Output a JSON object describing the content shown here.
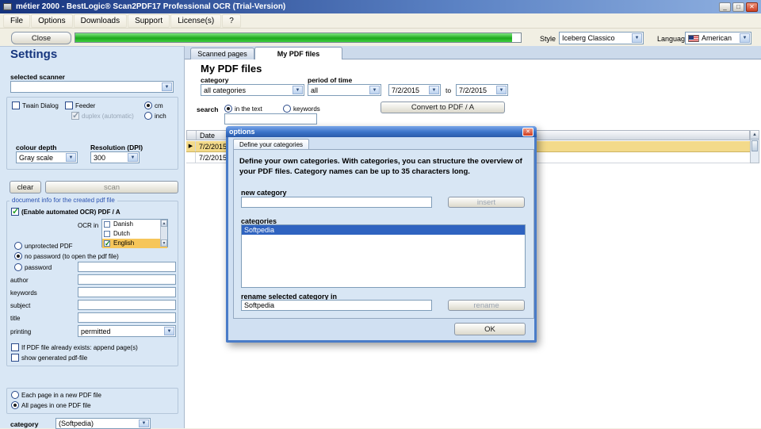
{
  "window": {
    "title": "métier 2000 - BestLogic® Scan2PDF17 Professional OCR (Trial-Version)",
    "controls": {
      "minimize": "_",
      "maximize": "□",
      "close": "✕"
    }
  },
  "menu": {
    "items": [
      "File",
      "Options",
      "Downloads",
      "Support",
      "License(s)",
      "?"
    ]
  },
  "toolbar": {
    "close_label": "Close",
    "progress_percent": 98,
    "style_label": "Style",
    "style_value": "Iceberg Classico",
    "language_label": "Language",
    "language_value": "American"
  },
  "settings": {
    "title": "Settings",
    "scanner_label": "selected scanner",
    "twain_label": "Twain Dialog",
    "feeder_label": "Feeder",
    "duplex_label": "duplex (automatic)",
    "cm_label": "cm",
    "inch_label": "inch",
    "colour_depth_label": "colour depth",
    "colour_depth_value": "Gray scale",
    "resolution_label": "Resolution (DPI)",
    "resolution_value": "300",
    "clear_label": "clear",
    "scan_label": "scan",
    "docinfo_title": "document info for the created pdf file",
    "ocr_checkbox_label": "(Enable automated OCR) PDF / A",
    "ocr_in_label": "OCR in",
    "ocr_languages": [
      {
        "label": "Danish",
        "checked": false
      },
      {
        "label": "Dutch",
        "checked": false
      },
      {
        "label": "English",
        "checked": true
      }
    ],
    "unprotected_label": "unprotected PDF",
    "no_password_label": "no password (to open the pdf file)",
    "password_label": "password",
    "author_label": "author",
    "keywords_label": "keywords",
    "subject_label": "subject",
    "title_label": "title",
    "printing_label": "printing",
    "printing_value": "permitted",
    "append_label": "If PDF file already exists: append page(s)",
    "show_generated_label": "show generated pdf-file",
    "each_page_label": "Each page in a new PDF file",
    "all_pages_label": "All pages in one PDF file",
    "category_label": "category",
    "category_value": "(Softpedia)"
  },
  "main": {
    "tabs": [
      {
        "label": "Scanned pages"
      },
      {
        "label": "My PDF files"
      }
    ],
    "heading": "My PDF files",
    "category_label": "category",
    "category_value": "all categories",
    "period_label": "period of time",
    "period_value": "all",
    "date_from": "7/2/2015",
    "to_label": "to",
    "date_to": "7/2/2015",
    "search_label": "search",
    "in_text_label": "in the text",
    "keywords_label": "keywords",
    "convert_label": "Convert to PDF / A",
    "table": {
      "date_column": "Date",
      "rows": [
        {
          "date": "7/2/2015",
          "selected": true
        },
        {
          "date": "7/2/2015",
          "selected": false
        }
      ]
    }
  },
  "dialog": {
    "title": "options",
    "close": "✕",
    "tab_label": "Define your categories",
    "description": "Define your own categories. With categories, you can structure the overview of your PDF files. Category names can be up to 35 characters long.",
    "new_category_label": "new category",
    "insert_label": "insert",
    "categories_label": "categories",
    "categories": [
      "Softpedia"
    ],
    "rename_label": "rename selected category in",
    "rename_value": "Softpedia",
    "rename_button_label": "rename",
    "ok_label": "OK"
  }
}
